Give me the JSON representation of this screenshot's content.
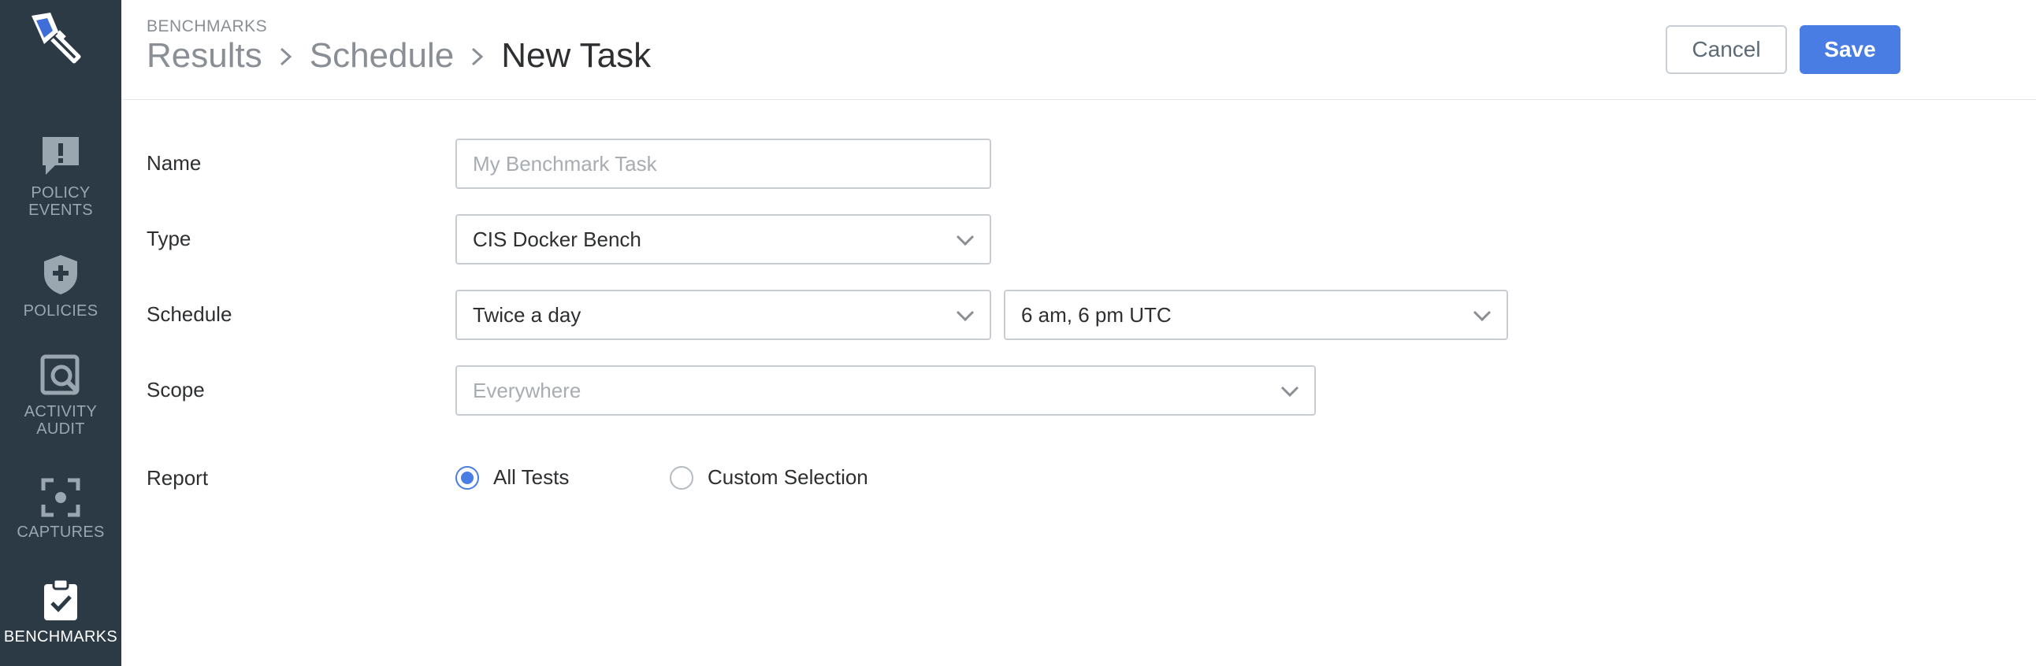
{
  "sidebar": {
    "items": [
      {
        "label": "POLICY\nEVENTS",
        "icon": "alert-message-icon"
      },
      {
        "label": "POLICIES",
        "icon": "shield-plus-icon"
      },
      {
        "label": "ACTIVITY\nAUDIT",
        "icon": "search-window-icon"
      },
      {
        "label": "CAPTURES",
        "icon": "capture-frame-icon"
      },
      {
        "label": "BENCHMARKS",
        "icon": "clipboard-check-icon",
        "active": true
      }
    ],
    "background": "#2c3a46"
  },
  "header": {
    "section": "BENCHMARKS",
    "breadcrumb": [
      "Results",
      "Schedule",
      "New Task"
    ],
    "cancel_label": "Cancel",
    "save_label": "Save"
  },
  "form": {
    "name": {
      "label": "Name",
      "placeholder": "My Benchmark Task",
      "value": ""
    },
    "type": {
      "label": "Type",
      "value": "CIS Docker Bench"
    },
    "schedule": {
      "label": "Schedule",
      "frequency": "Twice a day",
      "time": "6 am, 6 pm UTC"
    },
    "scope": {
      "label": "Scope",
      "placeholder": "Everywhere"
    },
    "report": {
      "label": "Report",
      "options": [
        {
          "label": "All Tests",
          "checked": true
        },
        {
          "label": "Custom Selection",
          "checked": false
        }
      ]
    }
  },
  "colors": {
    "accent": "#4a7de4",
    "text": "#2d2f31",
    "muted": "#8a8f95"
  }
}
